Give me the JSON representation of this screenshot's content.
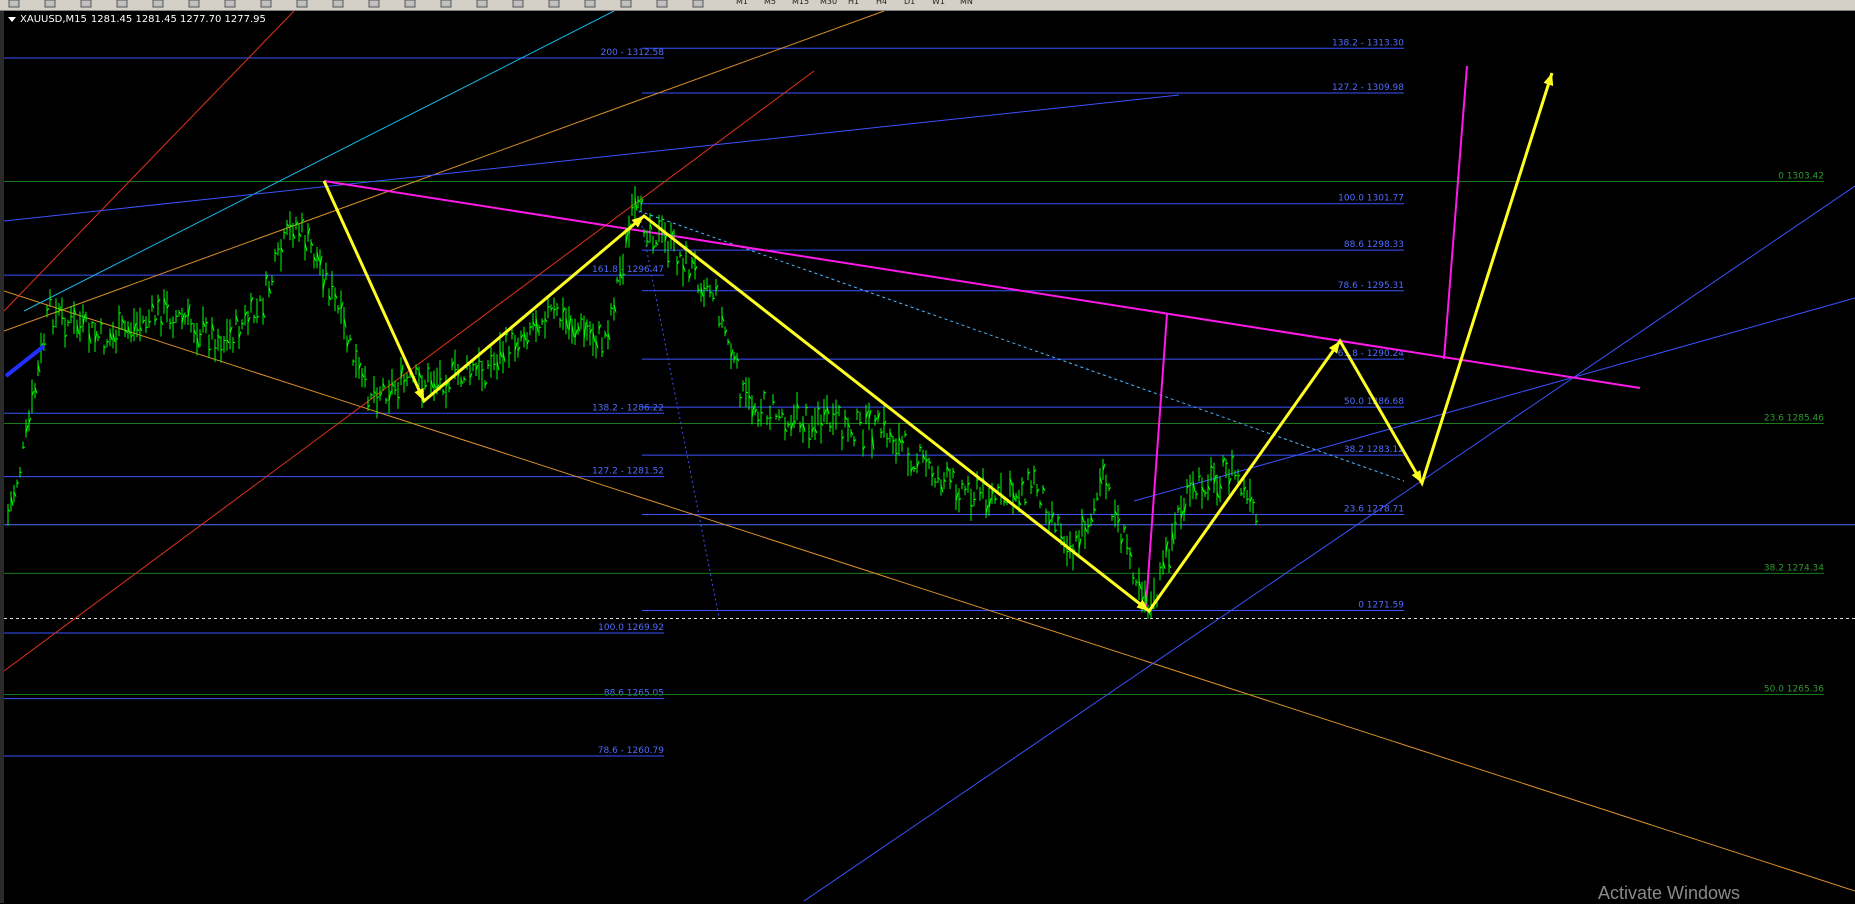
{
  "toolbar": {
    "buttons": [
      {
        "name": "new-chart-icon"
      },
      {
        "name": "open-icon"
      },
      {
        "name": "grid-icon"
      },
      {
        "name": "bar-chart-icon"
      },
      {
        "name": "candles-icon"
      },
      {
        "name": "zoom-in-icon"
      },
      {
        "name": "zoom-out-icon"
      },
      {
        "name": "tile-icon"
      },
      {
        "name": "scroll-icon"
      },
      {
        "name": "add-indicator-icon"
      },
      {
        "name": "clock-icon"
      },
      {
        "name": "template-icon"
      },
      {
        "name": "cursor-icon"
      },
      {
        "name": "crosshair-icon"
      },
      {
        "name": "vertical-line-icon"
      },
      {
        "name": "trendline-icon"
      },
      {
        "name": "fibo-icon"
      },
      {
        "name": "text-icon"
      },
      {
        "name": "label-icon"
      },
      {
        "name": "arrow-icon"
      }
    ],
    "timeframes": [
      "M1",
      "M5",
      "M15",
      "M30",
      "H1",
      "H4",
      "D1",
      "W1",
      "MN"
    ]
  },
  "chart": {
    "symbol": "XAUUSD,M15",
    "ohlc": "1281.45 1281.45 1277.70 1277.95",
    "watermark": "Activate Windows"
  },
  "colors": {
    "background": "#000000",
    "candles": "#00ff00",
    "fibo_blue": "#3a52ff",
    "fibo_green": "#1a7a1a",
    "fibo_text_blue": "#4f6cff",
    "fibo_text_green": "#2e9a2e",
    "path": "#ffff22",
    "magenta": "#ff1ae8",
    "orange": "#d8902a",
    "red": "#e0321a",
    "cyan": "#1ab4e8",
    "bid": "#e0e0e0"
  },
  "levels": {
    "left_fibo": [
      {
        "label": "200 - 1312.58",
        "price": 1312.58
      },
      {
        "label": "161.8 - 1296.47",
        "price": 1296.47
      },
      {
        "label": "138.2 - 1286.22",
        "price": 1286.22
      },
      {
        "label": "127.2 - 1281.52",
        "price": 1281.52
      },
      {
        "label": "100.0 1269.92",
        "price": 1269.92
      },
      {
        "label": "88.6 1265.05",
        "price": 1265.05
      },
      {
        "label": "78.6 - 1260.79",
        "price": 1260.79
      }
    ],
    "mid_fibo": [
      {
        "label": "138.2 - 1313.30",
        "price": 1313.3
      },
      {
        "label": "127.2 - 1309.98",
        "price": 1309.98
      },
      {
        "label": "100.0 1301.77",
        "price": 1301.77
      },
      {
        "label": "88.6 1298.33",
        "price": 1298.33
      },
      {
        "label": "78.6 - 1295.31",
        "price": 1295.31
      },
      {
        "label": "61.8 - 1290.24",
        "price": 1290.24
      },
      {
        "label": "50.0 1286.68",
        "price": 1286.68
      },
      {
        "label": "38.2 1283.12",
        "price": 1283.12
      },
      {
        "label": "23.6 1278.71",
        "price": 1278.71
      },
      {
        "label": "0 1271.59",
        "price": 1271.59
      }
    ],
    "right_fibo": [
      {
        "label": "0 1303.42",
        "price": 1303.42
      },
      {
        "label": "23.6 1285.46",
        "price": 1285.46
      },
      {
        "label": "38.2 1274.34",
        "price": 1274.34
      },
      {
        "label": "50.0 1265.36",
        "price": 1265.36
      }
    ]
  }
}
